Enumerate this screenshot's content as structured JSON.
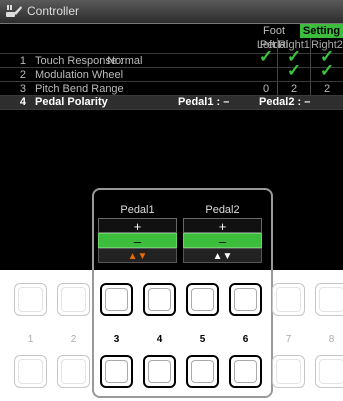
{
  "window": {
    "title": "Controller",
    "icon": "keyboard-pedal-icon"
  },
  "tabs": [
    {
      "label": "Foot Pedal",
      "active": false
    },
    {
      "label": "Setting",
      "active": true
    }
  ],
  "columns": [
    "Left",
    "Right1",
    "Right2"
  ],
  "rows": [
    {
      "num": "1",
      "label": "Touch Response :",
      "value": "Normal",
      "left": "✓",
      "right1": "✓",
      "right2": "✓"
    },
    {
      "num": "2",
      "label": "Modulation Wheel",
      "value": "",
      "left": "",
      "right1": "✓",
      "right2": "✓"
    },
    {
      "num": "3",
      "label": "Pitch Bend Range",
      "value": "",
      "left": "0",
      "right1": "2",
      "right2": "2"
    },
    {
      "num": "4",
      "label": "Pedal Polarity",
      "pedal1": "Pedal1 :  –",
      "pedal2": "Pedal2 :  –"
    }
  ],
  "popup": {
    "pedal1": {
      "name": "Pedal1",
      "plus": "+",
      "minus": "–",
      "arrows": "▲▼"
    },
    "pedal2": {
      "name": "Pedal2",
      "plus": "+",
      "minus": "–",
      "arrows": "▲▼"
    }
  },
  "buttons": [
    "1",
    "2",
    "3",
    "4",
    "5",
    "6",
    "7",
    "8"
  ],
  "colors": {
    "accent_green": "#3cbe3c",
    "arrow_orange": "#e86a00"
  }
}
